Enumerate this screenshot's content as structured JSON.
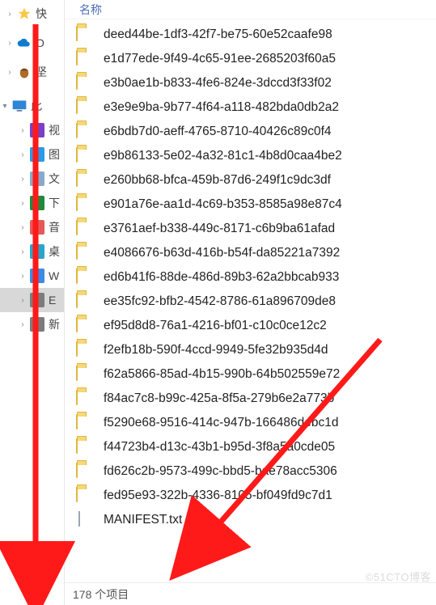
{
  "sidebar": {
    "top": [
      {
        "label": "快",
        "icon": "star",
        "color": "#f7c948"
      },
      {
        "label": "O",
        "icon": "cloud",
        "color": "#0e7bd0"
      },
      {
        "label": "坚",
        "icon": "nut",
        "color": "#b06a2b"
      }
    ],
    "thispc_label": "此",
    "drives": [
      {
        "label": "视",
        "icon": "video",
        "color": "#7b3fc9"
      },
      {
        "label": "图",
        "icon": "pictures",
        "color": "#2b9ae8"
      },
      {
        "label": "文",
        "icon": "doc",
        "color": "#8aa9c9"
      },
      {
        "label": "下",
        "icon": "downloads",
        "color": "#1f8a3b"
      },
      {
        "label": "音",
        "icon": "music",
        "color": "#e45a5a"
      },
      {
        "label": "桌",
        "icon": "desktop",
        "color": "#2aa5c9"
      },
      {
        "label": "W",
        "icon": "windows",
        "color": "#3c8ae6"
      },
      {
        "label": "E",
        "icon": "drive",
        "color": "#7c7c7c",
        "hl": true
      },
      {
        "label": "新",
        "icon": "drive2",
        "color": "#7c7c7c"
      }
    ]
  },
  "header": {
    "name_col": "名称"
  },
  "files": [
    {
      "name": "deed44be-1df3-42f7-be75-60e52caafe98",
      "type": "folder"
    },
    {
      "name": "e1d77ede-9f49-4c65-91ee-2685203f60a5",
      "type": "folder"
    },
    {
      "name": "e3b0ae1b-b833-4fe6-824e-3dccd3f33f02",
      "type": "folder"
    },
    {
      "name": "e3e9e9ba-9b77-4f64-a118-482bda0db2a2",
      "type": "folder"
    },
    {
      "name": "e6bdb7d0-aeff-4765-8710-40426c89c0f4",
      "type": "folder"
    },
    {
      "name": "e9b86133-5e02-4a32-81c1-4b8d0caa4be2",
      "type": "folder"
    },
    {
      "name": "e260bb68-bfca-459b-87d6-249f1c9dc3df",
      "type": "folder"
    },
    {
      "name": "e901a76e-aa1d-4c69-b353-8585a98e87c4",
      "type": "folder"
    },
    {
      "name": "e3761aef-b338-449c-8171-c6b9ba61afad",
      "type": "folder"
    },
    {
      "name": "e4086676-b63d-416b-b54f-da85221a7392",
      "type": "folder"
    },
    {
      "name": "ed6b41f6-88de-486d-89b3-62a2bbcab933",
      "type": "folder"
    },
    {
      "name": "ee35fc92-bfb2-4542-8786-61a896709de8",
      "type": "folder"
    },
    {
      "name": "ef95d8d8-76a1-4216-bf01-c10c0ce12c2",
      "type": "folder"
    },
    {
      "name": "f2efb18b-590f-4ccd-9949-5fe32b935d4d",
      "type": "folder"
    },
    {
      "name": "f62a5866-85ad-4b15-990b-64b502559e72",
      "type": "folder"
    },
    {
      "name": "f84ac7c8-b99c-425a-8f5a-279b6e2a773b",
      "type": "folder"
    },
    {
      "name": "f5290e68-9516-414c-947b-166486debc1d",
      "type": "folder"
    },
    {
      "name": "f44723b4-d13c-43b1-b95d-3f8a5a0cde05",
      "type": "folder"
    },
    {
      "name": "fd626c2b-9573-499c-bbd5-bae78acc5306",
      "type": "folder"
    },
    {
      "name": "fed95e93-322b-4336-8105-bf049fd9c7d1",
      "type": "folder"
    },
    {
      "name": "MANIFEST.txt",
      "type": "file"
    }
  ],
  "status": {
    "text": "178 个项目"
  },
  "watermark": "©51CTO博客"
}
